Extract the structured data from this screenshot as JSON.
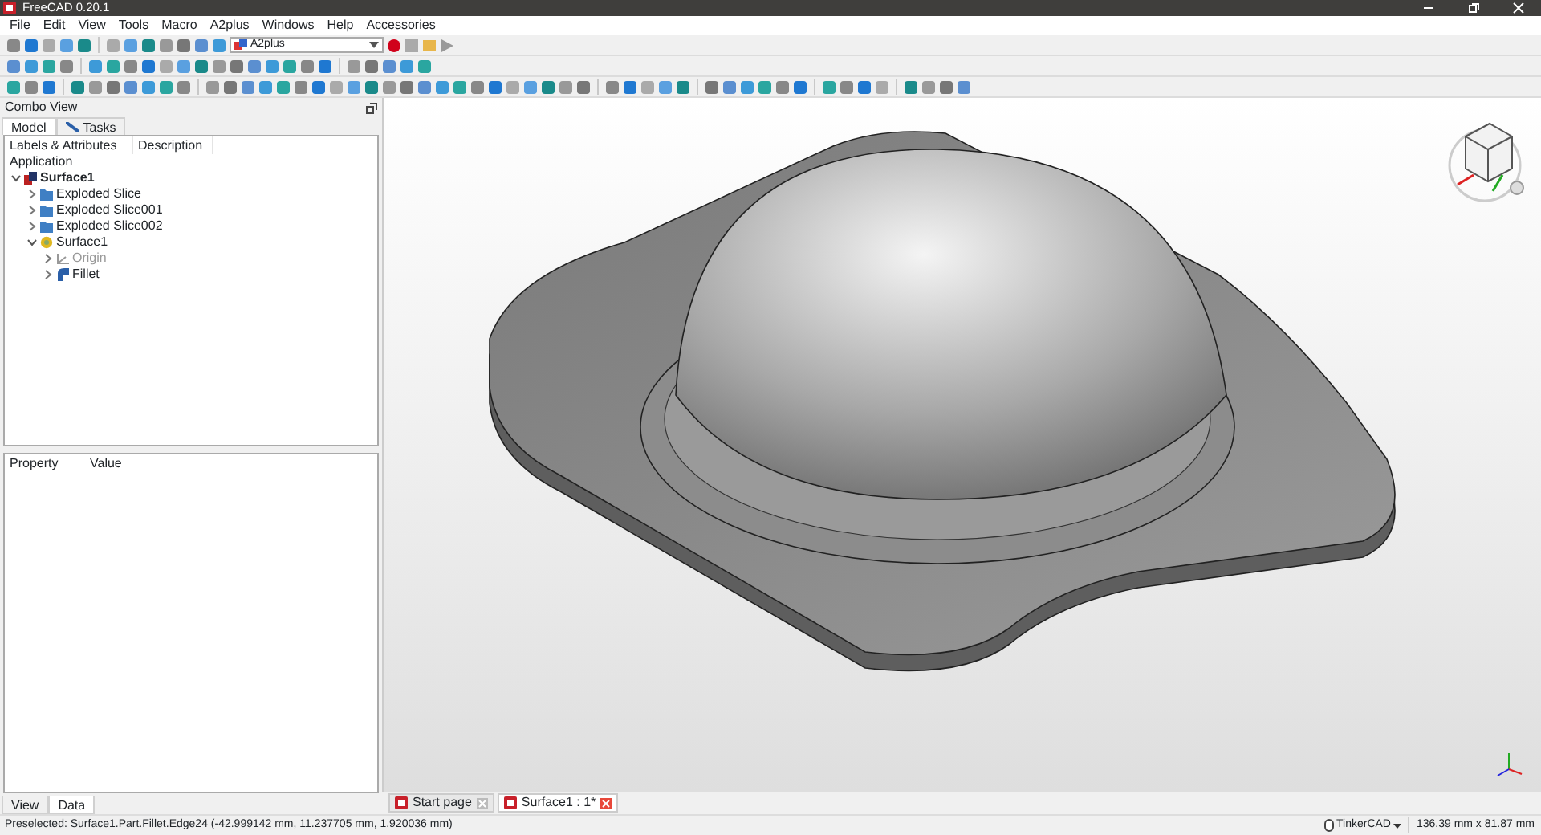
{
  "window": {
    "title": "FreeCAD 0.20.1"
  },
  "menu": [
    "File",
    "Edit",
    "View",
    "Tools",
    "Macro",
    "A2plus",
    "Windows",
    "Help",
    "Accessories"
  ],
  "workbench_selector": {
    "value": "A2plus"
  },
  "combo_view": {
    "title": "Combo View",
    "tabs": [
      {
        "label": "Model",
        "selected": true
      },
      {
        "label": "Tasks",
        "selected": false
      }
    ],
    "tree_columns": [
      "Labels & Attributes",
      "Description"
    ],
    "tree_group": "Application",
    "tree": [
      {
        "label": "Surface1",
        "kind": "document",
        "expanded": true,
        "disabled": false,
        "children": [
          {
            "label": "Exploded Slice",
            "kind": "folder",
            "expanded": false,
            "disabled": false
          },
          {
            "label": "Exploded Slice001",
            "kind": "folder",
            "expanded": false,
            "disabled": false
          },
          {
            "label": "Exploded Slice002",
            "kind": "folder",
            "expanded": false,
            "disabled": false
          },
          {
            "label": "Surface1",
            "kind": "body",
            "expanded": true,
            "disabled": false,
            "children": [
              {
                "label": "Origin",
                "kind": "origin",
                "expanded": false,
                "disabled": true
              },
              {
                "label": "Fillet",
                "kind": "feature",
                "expanded": false,
                "disabled": false
              }
            ]
          }
        ]
      }
    ],
    "property_columns": [
      "Property",
      "Value"
    ],
    "bottom_tabs": [
      {
        "label": "View",
        "selected": false
      },
      {
        "label": "Data",
        "selected": true
      }
    ]
  },
  "document_tabs": [
    {
      "label": "Start page",
      "selected": false
    },
    {
      "label": "Surface1 : 1*",
      "selected": true
    }
  ],
  "status_bar": {
    "message": "Preselected: Surface1.Part.Fillet.Edge24 (-42.999142 mm, 11.237705 mm, 1.920036 mm)",
    "navigation_style": "TinkerCAD",
    "dimensions": "136.39 mm x 81.87 mm"
  }
}
